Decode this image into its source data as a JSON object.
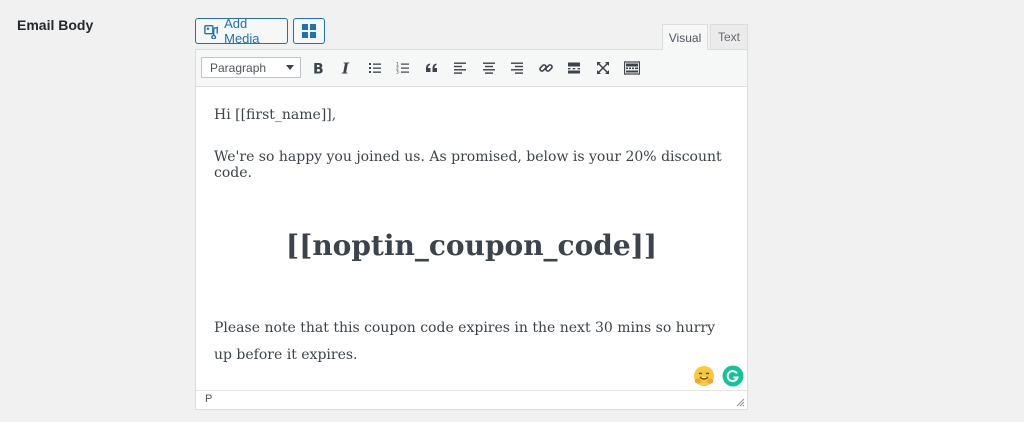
{
  "field": {
    "label": "Email Body"
  },
  "media": {
    "add_media_label": "Add Media"
  },
  "tabs": {
    "visual": "Visual",
    "text": "Text"
  },
  "toolbar": {
    "format_value": "Paragraph",
    "buttons": [
      {
        "name": "bold-icon"
      },
      {
        "name": "italic-icon"
      },
      {
        "name": "bullet-list-icon"
      },
      {
        "name": "numbered-list-icon"
      },
      {
        "name": "blockquote-icon"
      },
      {
        "name": "align-left-icon"
      },
      {
        "name": "align-center-icon"
      },
      {
        "name": "align-right-icon"
      },
      {
        "name": "link-icon"
      },
      {
        "name": "read-more-icon"
      },
      {
        "name": "fullscreen-icon"
      },
      {
        "name": "toolbar-toggle-icon"
      }
    ]
  },
  "content": {
    "greeting": "Hi [[first_name]],",
    "intro": "We're so happy you joined us. As promised, below is your 20% discount code.",
    "coupon": "[[noptin_coupon_code]]",
    "note": "Please note that this coupon code expires in the next 30 mins so hurry up before it expires."
  },
  "status": {
    "path": "P"
  },
  "colors": {
    "accent": "#2271b1",
    "grammarly": "#15c39a"
  }
}
